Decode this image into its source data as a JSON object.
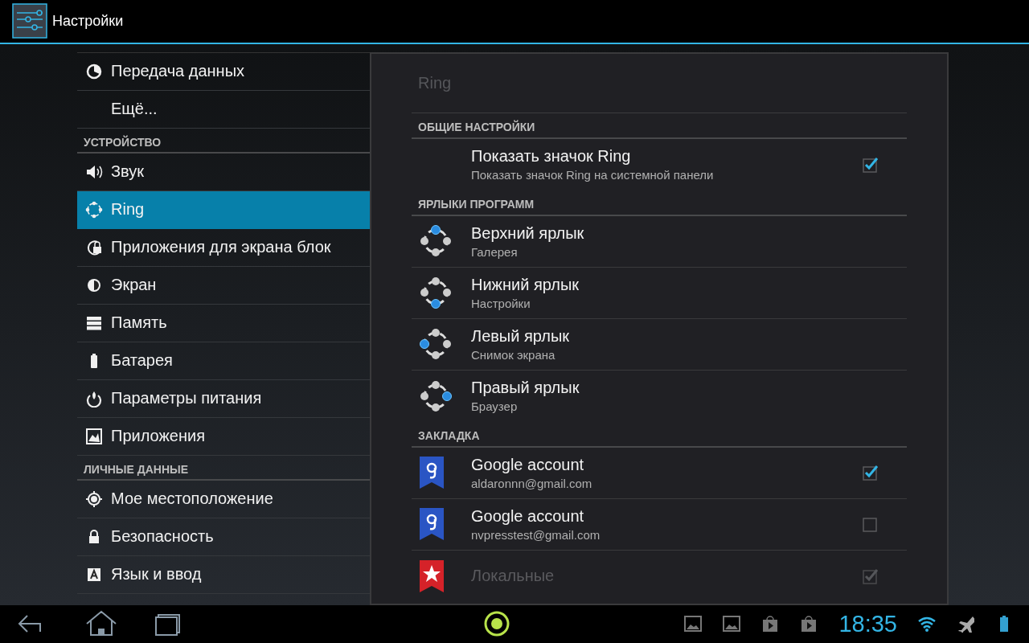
{
  "action_bar": {
    "title": "Настройки"
  },
  "sidebar": {
    "items": [
      {
        "kind": "item",
        "label": "Передача данных",
        "selected": false
      },
      {
        "kind": "item",
        "label": "Ещё...",
        "selected": false
      },
      {
        "kind": "header",
        "label": "УСТРОЙСТВО"
      },
      {
        "kind": "item",
        "label": "Звук",
        "selected": false
      },
      {
        "kind": "item",
        "label": "Ring",
        "selected": true
      },
      {
        "kind": "item",
        "label": "Приложения для экрана блок",
        "selected": false
      },
      {
        "kind": "item",
        "label": "Экран",
        "selected": false
      },
      {
        "kind": "item",
        "label": "Память",
        "selected": false
      },
      {
        "kind": "item",
        "label": "Батарея",
        "selected": false
      },
      {
        "kind": "item",
        "label": "Параметры питания",
        "selected": false
      },
      {
        "kind": "item",
        "label": "Приложения",
        "selected": false
      },
      {
        "kind": "header",
        "label": "ЛИЧНЫЕ ДАННЫЕ"
      },
      {
        "kind": "item",
        "label": "Мое местоположение",
        "selected": false
      },
      {
        "kind": "item",
        "label": "Безопасность",
        "selected": false
      },
      {
        "kind": "item",
        "label": "Язык и ввод",
        "selected": false
      }
    ]
  },
  "panel": {
    "title": "Ring",
    "sections": [
      {
        "header": "ОБЩИЕ НАСТРОЙКИ",
        "rows": [
          {
            "kind": "toggle",
            "title": "Показать значок Ring",
            "summary": "Показать значок Ring на системной панели",
            "checked": true
          }
        ]
      },
      {
        "header": "ЯРЛЫКИ ПРОГРАММ",
        "rows": [
          {
            "kind": "shortcut",
            "title": "Верхний ярлык",
            "summary": "Галерея"
          },
          {
            "kind": "shortcut",
            "title": "Нижний ярлык",
            "summary": "Настройки"
          },
          {
            "kind": "shortcut",
            "title": "Левый ярлык",
            "summary": "Снимок экрана"
          },
          {
            "kind": "shortcut",
            "title": "Правый ярлык",
            "summary": "Браузер"
          }
        ]
      },
      {
        "header": "ЗАКЛАДКА",
        "rows": [
          {
            "kind": "google",
            "title": "Google account",
            "summary": "aldaronnn@gmail.com",
            "checked": true,
            "disabled": false
          },
          {
            "kind": "google",
            "title": "Google account",
            "summary": "nvpresstest@gmail.com",
            "checked": false,
            "disabled": false
          },
          {
            "kind": "local",
            "title": "Локальные",
            "checked": true,
            "disabled": true
          }
        ]
      }
    ]
  },
  "status_bar": {
    "time": "18:35"
  }
}
